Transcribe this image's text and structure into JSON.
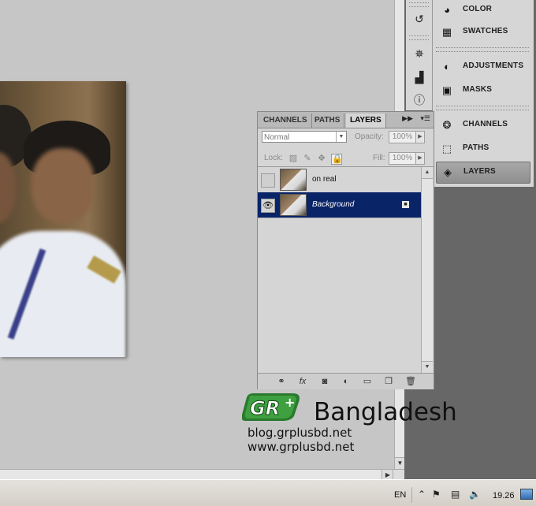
{
  "canvas": {},
  "dock": {
    "items": [
      {
        "label": "COLOR",
        "icon": "color-icon"
      },
      {
        "label": "SWATCHES",
        "icon": "swatches-icon"
      },
      {
        "label": "ADJUSTMENTS",
        "icon": "adjustments-icon"
      },
      {
        "label": "MASKS",
        "icon": "masks-icon"
      },
      {
        "label": "CHANNELS",
        "icon": "channels-icon"
      },
      {
        "label": "PATHS",
        "icon": "paths-icon"
      },
      {
        "label": "LAYERS",
        "icon": "layers-icon",
        "active": true
      }
    ],
    "collapsed_icons": [
      "history-icon",
      "navigator-icon",
      "histogram-icon",
      "info-icon"
    ]
  },
  "layers_panel": {
    "tabs": [
      "CHANNELS",
      "PATHS",
      "LAYERS"
    ],
    "active_tab": "LAYERS",
    "blend_mode": "Normal",
    "opacity_label": "Opacity:",
    "opacity_value": "100%",
    "lock_label": "Lock:",
    "fill_label": "Fill:",
    "fill_value": "100%",
    "layers": [
      {
        "name": "on real",
        "visible": false,
        "selected": false
      },
      {
        "name": "Background",
        "visible": true,
        "selected": true,
        "locked": true
      }
    ],
    "footer_icons": [
      "link-layers-icon",
      "fx-icon",
      "add-mask-icon",
      "adjustment-layer-icon",
      "new-group-icon",
      "new-layer-icon",
      "delete-layer-icon"
    ]
  },
  "watermark": {
    "logo_text": "GR+",
    "brand": "Bangladesh",
    "url1": "blog.grplusbd.net",
    "url2": "www.grplusbd.net"
  },
  "taskbar": {
    "language": "EN",
    "clock": "19.26"
  }
}
